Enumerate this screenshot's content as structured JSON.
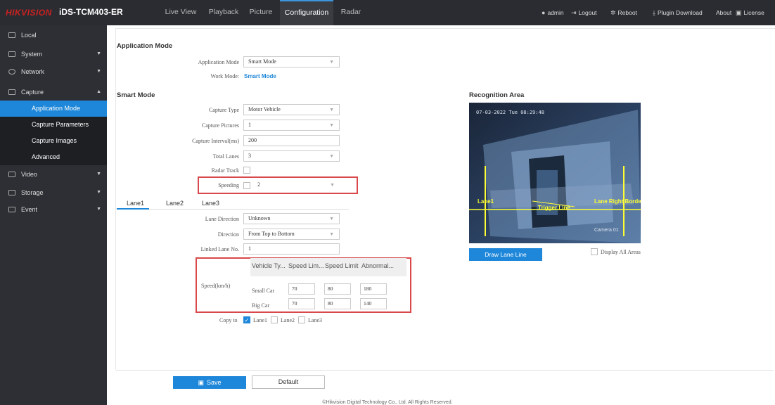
{
  "header": {
    "brand": "HIKVISION",
    "model": "iDS-TCM403-ER",
    "nav": [
      "Live View",
      "Playback",
      "Picture",
      "Configuration",
      "Radar"
    ],
    "user": "admin",
    "logout": "Logout",
    "reboot": "Reboot",
    "plugin": "Plugin Download",
    "about": "About",
    "license": "License"
  },
  "sidebar": {
    "local": "Local",
    "system": "System",
    "network": "Network",
    "capture": "Capture",
    "sub": [
      "Application Mode",
      "Capture Parameters",
      "Capture Images",
      "Advanced"
    ],
    "video": "Video",
    "storage": "Storage",
    "event": "Event"
  },
  "app_mode": {
    "title": "Application Mode",
    "mode_label": "Application Mode",
    "mode_value": "Smart Mode",
    "work_label": "Work Mode:",
    "work_value": "Smart Mode"
  },
  "smart": {
    "title": "Smart Mode",
    "capture_type_label": "Capture Type",
    "capture_type_value": "Motor Vehicle",
    "capture_pictures_label": "Capture Pictures",
    "capture_pictures_value": "1",
    "interval_label": "Capture Interval(ms)",
    "interval_value": "200",
    "total_lanes_label": "Total Lanes",
    "total_lanes_value": "3",
    "radar_track_label": "Radar Track",
    "speeding_label": "Speeding",
    "speeding_value": "2"
  },
  "lanes": [
    "Lane1",
    "Lane2",
    "Lane3"
  ],
  "lane": {
    "direction_label": "Lane Direction",
    "direction_value": "Unknown",
    "dir_label": "Direction",
    "dir_value": "From Top to Bottom",
    "linked_label": "Linked Lane No.",
    "linked_value": "1",
    "speed_label": "Speed(km/h)",
    "headers": [
      "Vehicle Ty...",
      "Speed Lim...",
      "Speed Limit",
      "Abnormal..."
    ],
    "rows": [
      {
        "type": "Small Car",
        "v1": "70",
        "v2": "80",
        "v3": "180"
      },
      {
        "type": "Big Car",
        "v1": "70",
        "v2": "80",
        "v3": "140"
      }
    ],
    "copy_to": "Copy to",
    "copy_lanes": [
      "Lane1",
      "Lane2",
      "Lane3"
    ]
  },
  "recognition": {
    "title": "Recognition Area",
    "timestamp": "07-03-2022 Tue 08:29:48",
    "lane1": "Lane1",
    "lane_right": "Lane Right Borde",
    "trigger": "Trigger Line",
    "corner_tag": "Camera 01",
    "draw_button": "Draw Lane Line",
    "display_all": "Display All Areas"
  },
  "actions": {
    "save": "Save",
    "default": "Default"
  },
  "footer": "©Hikvision Digital Technology Co., Ltd. All Rights Reserved."
}
